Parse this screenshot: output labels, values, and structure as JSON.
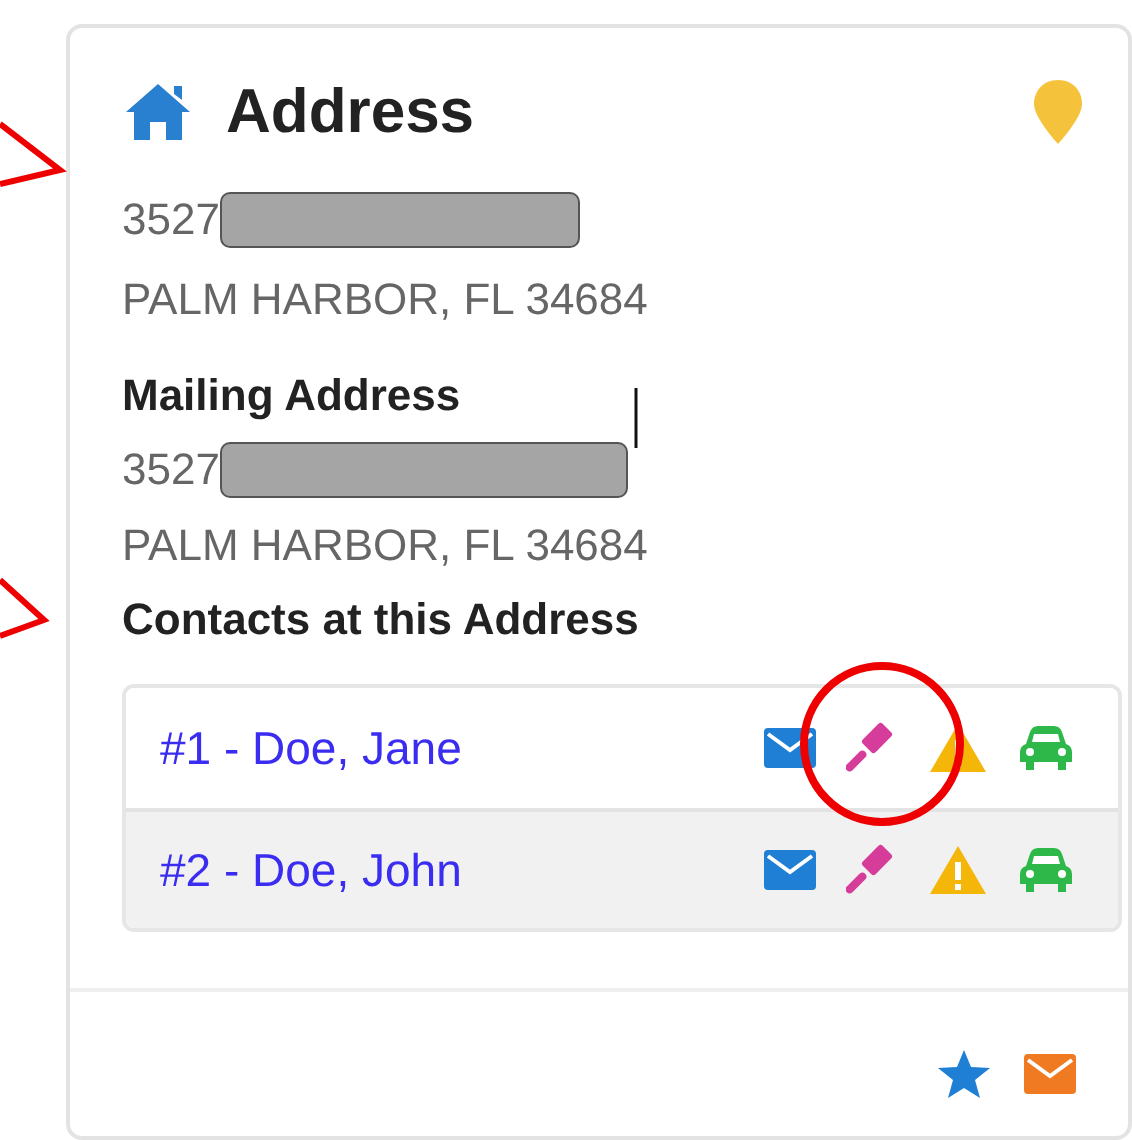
{
  "card": {
    "title": "Address",
    "address": {
      "street": "3527",
      "city": "PALM HARBOR, FL 34684"
    },
    "mailing": {
      "heading": "Mailing Address",
      "street": "3527",
      "city": "PALM HARBOR, FL 34684"
    },
    "contacts_heading": "Contacts at this Address",
    "contacts": [
      {
        "name": "#1 - Doe, Jane"
      },
      {
        "name": "#2 - Doe, John"
      }
    ]
  }
}
